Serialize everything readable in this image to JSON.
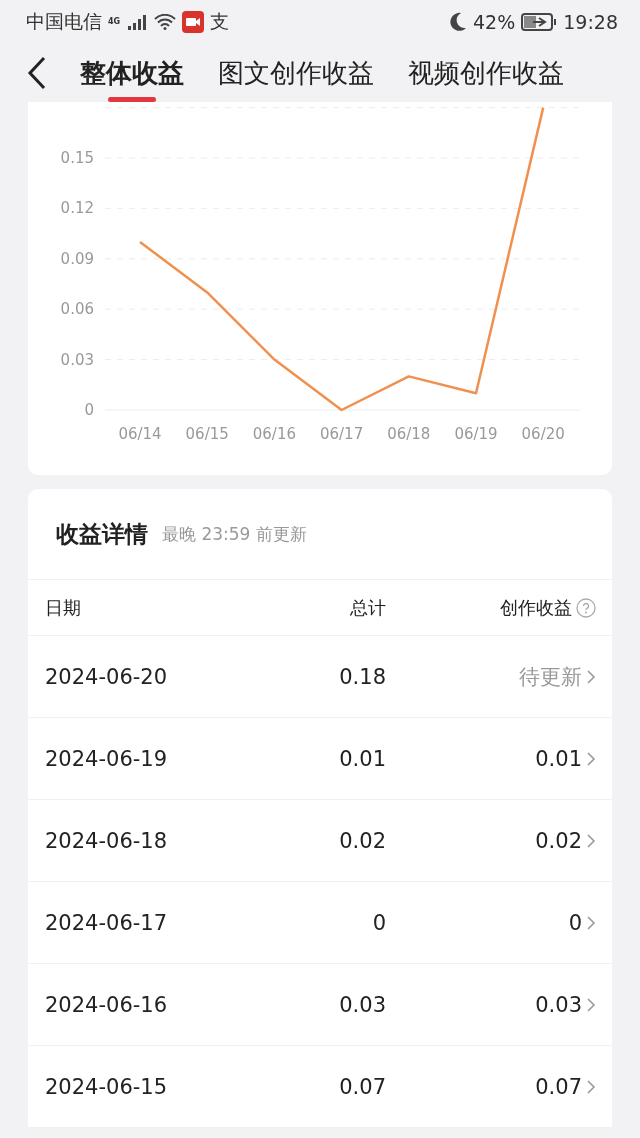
{
  "status_bar": {
    "carrier": "中国电信",
    "network": "4G",
    "notice_glyph": "支",
    "battery": "42%",
    "time": "19:28"
  },
  "tabs": [
    {
      "label": "整体收益",
      "selected": true
    },
    {
      "label": "图文创作收益",
      "selected": false
    },
    {
      "label": "视频创作收益",
      "selected": false
    }
  ],
  "chart": {
    "chart_data": {
      "type": "line",
      "categories": [
        "06/14",
        "06/15",
        "06/16",
        "06/17",
        "06/18",
        "06/19",
        "06/20"
      ],
      "series": [
        {
          "color": "#f0904f",
          "values": [
            0.1,
            0.07,
            0.03,
            0,
            0.02,
            0.01,
            0.18
          ]
        }
      ],
      "grid": true,
      "ylim": [
        0,
        0.18
      ],
      "yticks": [
        {
          "value": 0,
          "label": "0"
        },
        {
          "value": 0.03,
          "label": "0.03"
        },
        {
          "value": 0.06,
          "label": "0.06"
        },
        {
          "value": 0.09,
          "label": "0.09"
        },
        {
          "value": 0.12,
          "label": "0.12"
        },
        {
          "value": 0.15,
          "label": "0.15"
        }
      ]
    }
  },
  "details": {
    "title": "收益详情",
    "subtitle": "最晚 23:59 前更新",
    "columns": [
      "日期",
      "总计",
      "创作收益"
    ],
    "rows": [
      {
        "date": "2024-06-20",
        "total": "0.18",
        "creation": "待更新",
        "pending": true
      },
      {
        "date": "2024-06-19",
        "total": "0.01",
        "creation": "0.01",
        "pending": false
      },
      {
        "date": "2024-06-18",
        "total": "0.02",
        "creation": "0.02",
        "pending": false
      },
      {
        "date": "2024-06-17",
        "total": "0",
        "creation": "0",
        "pending": false
      },
      {
        "date": "2024-06-16",
        "total": "0.03",
        "creation": "0.03",
        "pending": false
      },
      {
        "date": "2024-06-15",
        "total": "0.07",
        "creation": "0.07",
        "pending": false
      }
    ]
  }
}
